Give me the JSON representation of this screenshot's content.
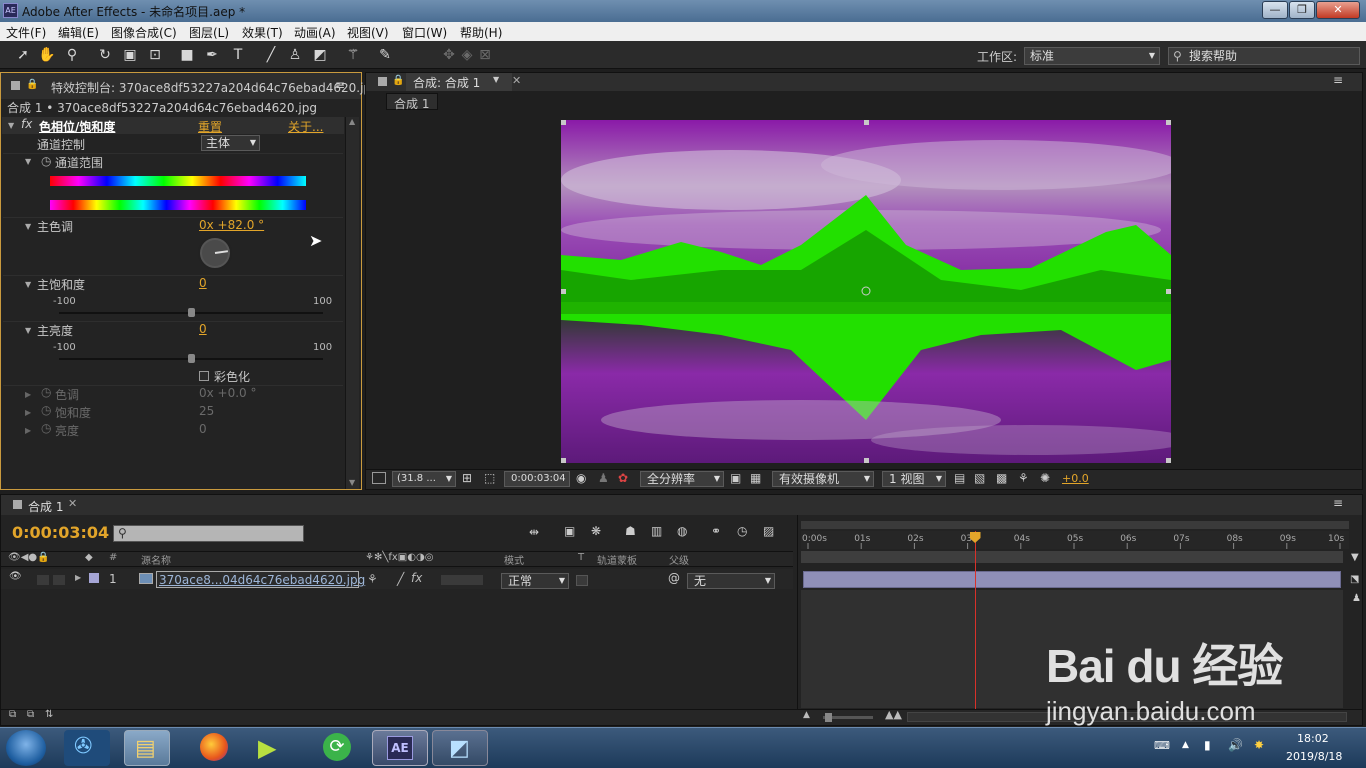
{
  "window": {
    "title": "Adobe After Effects - 未命名项目.aep *",
    "app_icon": "AE",
    "minimize": "—",
    "maximize": "❐",
    "close": "✕"
  },
  "menu": [
    "文件(F)",
    "编辑(E)",
    "图像合成(C)",
    "图层(L)",
    "效果(T)",
    "动画(A)",
    "视图(V)",
    "窗口(W)",
    "帮助(H)"
  ],
  "toolbar": {
    "workspace_label": "工作区:",
    "workspace_value": "标准",
    "search_placeholder": "搜索帮助"
  },
  "effects_panel": {
    "tab_title": "特效控制台: 370ace8df53227a204d64c76ebad4620.jp",
    "layer_path": "合成 1 • 370ace8df53227a204d64c76ebad4620.jpg",
    "effect_name": "色相位/饱和度",
    "reset": "重置",
    "about": "关于...",
    "channel_control_label": "通道控制",
    "channel_control_value": "主体",
    "channel_range_label": "通道范围",
    "master_hue_label": "主色调",
    "master_hue_value": "0x +82.0 °",
    "master_sat_label": "主饱和度",
    "master_sat_value": "0",
    "master_light_label": "主亮度",
    "master_light_value": "0",
    "slider_min": "-100",
    "slider_max": "100",
    "colorize_label": "彩色化",
    "colorize_checked": false,
    "hue_label": "色调",
    "hue_value": "0x +0.0 °",
    "saturation_label": "饱和度",
    "saturation_value": "25",
    "lightness_label": "亮度",
    "lightness_value": "0",
    "master_hue_degrees": 82,
    "master_sat_level": 0.5,
    "master_light_level": 0.5
  },
  "comp_panel": {
    "tab_title": "合成: 合成 1",
    "breadcrumb": "合成 1",
    "zoom": "(31.8 ...",
    "timecode": "0:00:03:04",
    "resolution": "全分辨率",
    "camera": "有效摄像机",
    "views": "1 视图",
    "exposure": "+0.0"
  },
  "timeline": {
    "tab_title": "合成 1",
    "current_time": "0:00:03:04",
    "columns": {
      "source": "源名称",
      "mode": "模式",
      "t": "T",
      "track_matte": "轨道蒙板",
      "parent": "父级",
      "num": "#"
    },
    "ruler": [
      "0:00s",
      "01s",
      "02s",
      "03s",
      "04s",
      "05s",
      "06s",
      "07s",
      "08s",
      "09s",
      "10s"
    ],
    "playhead_seconds": 3.13,
    "duration_seconds": 10,
    "layer": {
      "index": "1",
      "name": "370ace8...04d64c76ebad4620.jpg",
      "mode": "正常",
      "parent": "无"
    }
  },
  "taskbar": {
    "time": "18:02",
    "date": "2019/8/18",
    "ae_label": "AE"
  },
  "watermark": {
    "brand": "Bai du 经验",
    "url": "jingyan.baidu.com"
  },
  "colors": {
    "accent_orange": "#e2a52a",
    "playhead_red": "#d8312a",
    "layer_bar": "#8f8fb8"
  }
}
